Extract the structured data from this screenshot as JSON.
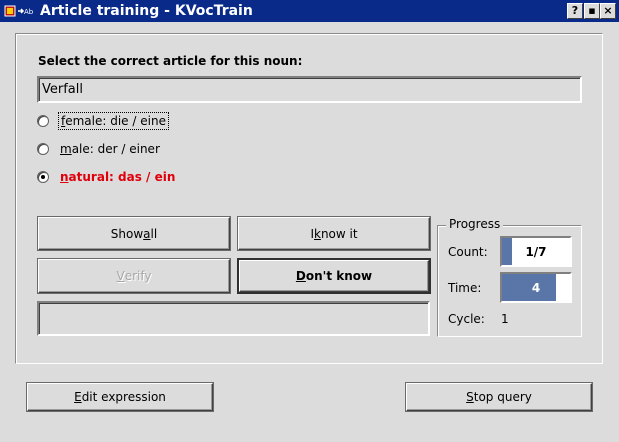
{
  "window": {
    "title": "Article training - KVocTrain",
    "buttons": {
      "help": "?",
      "minimize": "▪",
      "close": "×"
    }
  },
  "prompt": "Select the correct article for this noun:",
  "noun": "Verfall",
  "options": [
    {
      "pre": "",
      "key": "f",
      "post": "emale: die / eine",
      "selected": false,
      "focused": true
    },
    {
      "pre": "",
      "key": "m",
      "post": "ale: der / einer",
      "selected": false,
      "focused": false
    },
    {
      "pre": "",
      "key": "n",
      "post": "atural: das / ein",
      "selected": true,
      "focused": false
    }
  ],
  "buttons": {
    "show_all": {
      "pre": "Show ",
      "key": "a",
      "post": "ll"
    },
    "i_know_it": {
      "pre": "I ",
      "key": "k",
      "post": "now it"
    },
    "verify": {
      "pre": "",
      "key": "V",
      "post": "erify"
    },
    "dont_know": {
      "pre": "",
      "key": "D",
      "post": "on't know"
    },
    "edit_expression": {
      "pre": "",
      "key": "E",
      "post": "dit expression"
    },
    "stop_query": {
      "pre": "",
      "key": "S",
      "post": "top query"
    }
  },
  "status_text": "",
  "progress": {
    "title": "Progress",
    "count_label": "Count:",
    "count_value": "1/7",
    "count_fraction": 0.1429,
    "time_label": "Time:",
    "time_value": "4",
    "time_fraction": 0.8,
    "cycle_label": "Cycle:",
    "cycle_value": "1"
  },
  "colors": {
    "titlebar": "#0a2a8a",
    "selected_option": "#e0000b",
    "progress_fill": "#5a76a8"
  }
}
